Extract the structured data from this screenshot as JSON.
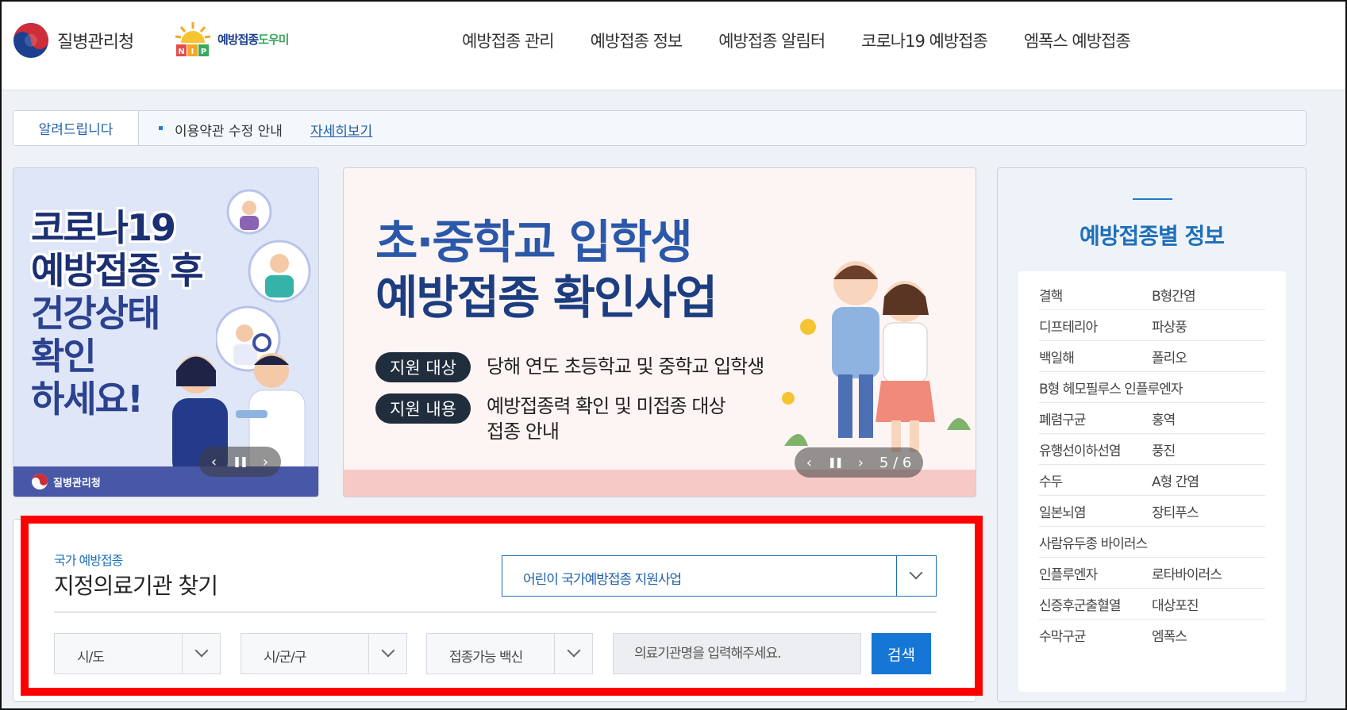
{
  "header": {
    "kdca_name": "질병관리청",
    "nip_name_part1": "예방접종",
    "nip_name_part2": "도우미",
    "nip_mark_text": "NIP",
    "nav": [
      "예방접종 관리",
      "예방접종 정보",
      "예방접종 알림터",
      "코로나19 예방접종",
      "엠폭스 예방접종"
    ]
  },
  "notice": {
    "tag": "알려드립니다",
    "text": "이용약관 수정 안내",
    "more": "자세히보기"
  },
  "banner_left": {
    "line1": "코로나19",
    "line2": "예방접종 후",
    "line3": "건강상태",
    "line4": "확인",
    "line5": "하세요!",
    "footer": "질병관리청"
  },
  "banner_center": {
    "title1": "초·중학교 입학생",
    "title2": "예방접종 확인사업",
    "pill1": "지원 대상",
    "pill1_text": "당해 연도 초등학교 및 중학교 입학생",
    "pill2": "지원 내용",
    "pill2_text_line1": "예방접종력 확인 및 미접종 대상",
    "pill2_text_line2": "접종 안내",
    "counter": "5 / 6"
  },
  "carousel_controls": {
    "prev": "‹",
    "pause": "❚❚",
    "next": "›"
  },
  "info_panel": {
    "title": "예방접종별 정보",
    "rows": [
      [
        "결핵",
        "B형간염"
      ],
      [
        "디프테리아",
        "파상풍"
      ],
      [
        "백일해",
        "폴리오"
      ],
      [
        "B형 헤모필루스 인플루엔자"
      ],
      [
        "폐렴구균",
        "홍역"
      ],
      [
        "유행선이하선염",
        "풍진"
      ],
      [
        "수두",
        "A형 간염"
      ],
      [
        "일본뇌염",
        "장티푸스"
      ],
      [
        "사람유두종 바이러스"
      ],
      [
        "인플루엔자",
        "로타바이러스"
      ],
      [
        "신증후군출혈열",
        "대상포진"
      ],
      [
        "수막구균",
        "엠폭스"
      ]
    ]
  },
  "search": {
    "subtitle": "국가 예방접종",
    "title": "지정의료기관 찾기",
    "program_select": "어린이 국가예방접종 지원사업",
    "sido": "시/도",
    "sigungu": "시/군/구",
    "vaccine": "접종가능 백신",
    "input_placeholder": "의료기관명을 입력해주세요.",
    "button": "검색"
  },
  "colors": {
    "accent": "#1576d6",
    "highlight": "#ff0000",
    "title_blue": "#1f6fb8"
  }
}
